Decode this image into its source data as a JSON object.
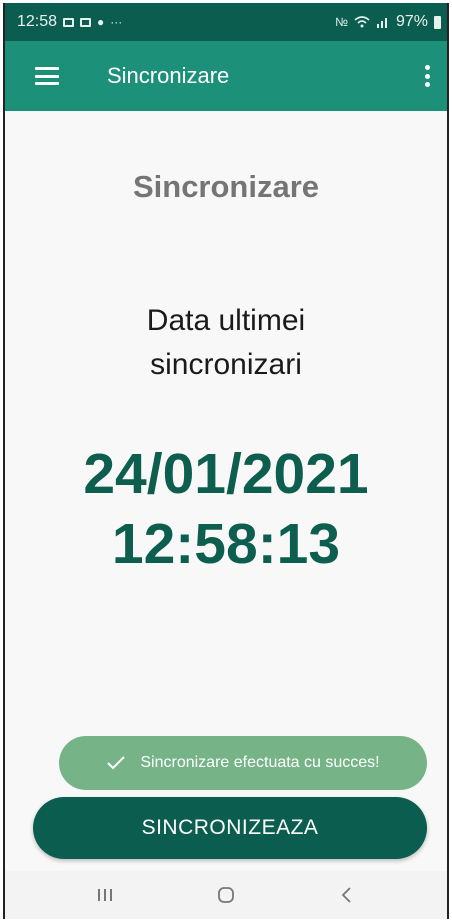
{
  "status_bar": {
    "time": "12:58",
    "left_icons": [
      "image-icon",
      "cast-icon",
      "bag-icon",
      "more-dots-icon"
    ],
    "right_icons": [
      "mute-icon",
      "wifi-icon",
      "signal-icon"
    ],
    "battery_text": "97%"
  },
  "app_bar": {
    "title": "Sincronizare",
    "menu_icon": "hamburger-menu-icon",
    "overflow_icon": "overflow-menu-icon"
  },
  "content": {
    "heading": "Sincronizare",
    "last_sync_label_line1": "Data ultimei",
    "last_sync_label_line2": "sincronizari",
    "last_sync_date": "24/01/2021",
    "last_sync_time": "12:58:13"
  },
  "toast": {
    "message": "Sincronizare efectuata cu succes!",
    "icon": "check-icon"
  },
  "sync_button": {
    "label": "SINCRONIZEAZA"
  },
  "nav_bar": {
    "items": [
      "recent-apps-icon",
      "home-icon",
      "back-icon"
    ]
  },
  "colors": {
    "status_bar": "#0b5e4f",
    "app_bar": "#1c9079",
    "accent_dark": "#0d5e4e",
    "toast": "#76b488",
    "heading_gray": "#757575"
  }
}
